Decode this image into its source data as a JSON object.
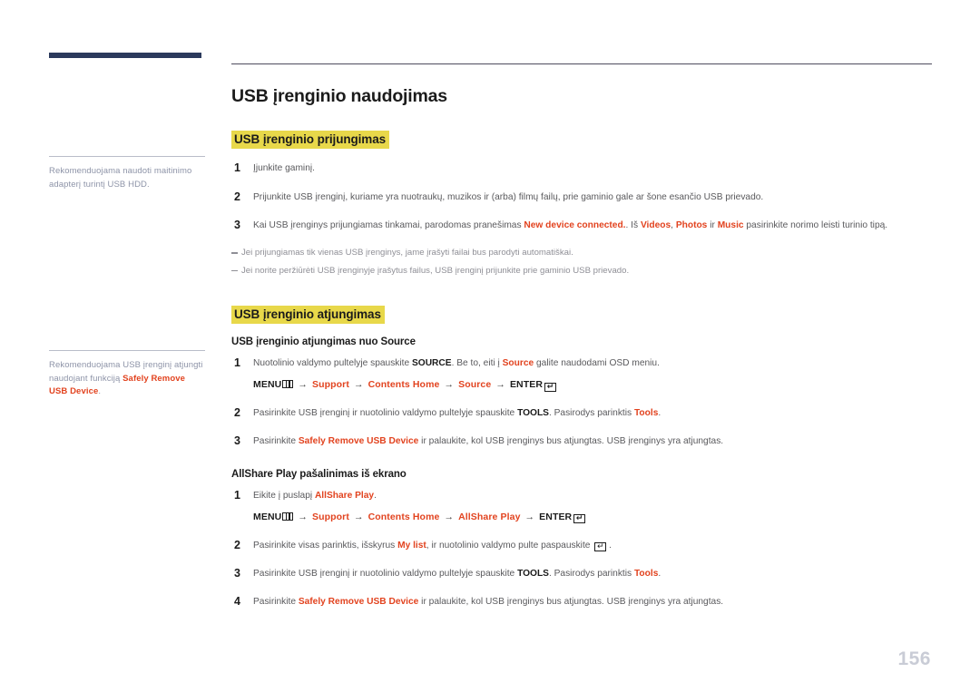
{
  "page": {
    "number": "156"
  },
  "sidebar": {
    "notes": [
      {
        "text_before": "Rekomenduojama naudoti maitinimo adapterį turintį USB HDD.",
        "emphasis": "",
        "text_after": ""
      },
      {
        "text_before": "Rekomenduojama USB įrenginį atjungti naudojant funkciją ",
        "emphasis": "Safely Remove USB Device",
        "text_after": "."
      }
    ]
  },
  "main": {
    "title": "USB įrenginio naudojimas",
    "sections": [
      {
        "heading": "USB įrenginio prijungimas",
        "steps": [
          {
            "num": "1",
            "parts": [
              {
                "t": "Įjunkite gaminį.",
                "s": "plain"
              }
            ]
          },
          {
            "num": "2",
            "parts": [
              {
                "t": "Prijunkite USB įrenginį, kuriame yra nuotraukų, muzikos ir (arba) filmų failų, prie gaminio gale ar šone esančio USB prievado.",
                "s": "plain"
              }
            ]
          },
          {
            "num": "3",
            "parts": [
              {
                "t": "Kai USB įrenginys prijungiamas tinkamai, parodomas pranešimas ",
                "s": "plain"
              },
              {
                "t": "New device connected.",
                "s": "hl"
              },
              {
                "t": ". Iš ",
                "s": "plain"
              },
              {
                "t": "Videos",
                "s": "hl"
              },
              {
                "t": ", ",
                "s": "plain"
              },
              {
                "t": "Photos",
                "s": "hl"
              },
              {
                "t": " ir ",
                "s": "plain"
              },
              {
                "t": "Music",
                "s": "hl"
              },
              {
                "t": " pasirinkite norimo leisti turinio tipą.",
                "s": "plain"
              }
            ]
          }
        ],
        "notes": [
          "Jei prijungiamas tik vienas USB įrenginys, jame įrašyti failai bus parodyti automatiškai.",
          "Jei norite peržiūrėti USB įrenginyje įrašytus failus, USB įrenginį prijunkite prie gaminio USB prievado."
        ]
      },
      {
        "heading": "USB įrenginio atjungimas",
        "subsections": [
          {
            "sub_heading": "USB įrenginio atjungimas nuo Source",
            "steps": [
              {
                "num": "1",
                "parts": [
                  {
                    "t": "Nuotolinio valdymo pultelyje spauskite ",
                    "s": "plain"
                  },
                  {
                    "t": "SOURCE",
                    "s": "bold"
                  },
                  {
                    "t": ". Be to, eiti į ",
                    "s": "plain"
                  },
                  {
                    "t": "Source",
                    "s": "hl"
                  },
                  {
                    "t": " galite naudodami OSD meniu.",
                    "s": "plain"
                  }
                ],
                "menupath": {
                  "lead": "MENU",
                  "items": [
                    "Support",
                    "Contents Home",
                    "Source"
                  ],
                  "tail": "ENTER"
                }
              },
              {
                "num": "2",
                "parts": [
                  {
                    "t": "Pasirinkite USB įrenginį ir nuotolinio valdymo pultelyje spauskite ",
                    "s": "plain"
                  },
                  {
                    "t": "TOOLS",
                    "s": "bold"
                  },
                  {
                    "t": ". Pasirodys parinktis ",
                    "s": "plain"
                  },
                  {
                    "t": "Tools",
                    "s": "hl"
                  },
                  {
                    "t": ".",
                    "s": "plain"
                  }
                ]
              },
              {
                "num": "3",
                "parts": [
                  {
                    "t": "Pasirinkite ",
                    "s": "plain"
                  },
                  {
                    "t": "Safely Remove USB Device",
                    "s": "hl"
                  },
                  {
                    "t": " ir palaukite, kol USB įrenginys bus atjungtas. USB įrenginys yra atjungtas.",
                    "s": "plain"
                  }
                ]
              }
            ]
          },
          {
            "sub_heading": "AllShare Play pašalinimas iš ekrano",
            "steps": [
              {
                "num": "1",
                "parts": [
                  {
                    "t": "Eikite į puslapį ",
                    "s": "plain"
                  },
                  {
                    "t": "AllShare Play",
                    "s": "hl"
                  },
                  {
                    "t": ".",
                    "s": "plain"
                  }
                ],
                "menupath": {
                  "lead": "MENU",
                  "items": [
                    "Support",
                    "Contents Home",
                    "AllShare Play"
                  ],
                  "tail": "ENTER"
                }
              },
              {
                "num": "2",
                "parts": [
                  {
                    "t": "Pasirinkite visas parinktis, išskyrus ",
                    "s": "plain"
                  },
                  {
                    "t": "My list",
                    "s": "hl"
                  },
                  {
                    "t": ", ir nuotolinio valdymo pulte paspauskite ",
                    "s": "plain"
                  },
                  {
                    "t": "[ENTER]",
                    "s": "enter"
                  },
                  {
                    "t": " .",
                    "s": "plain"
                  }
                ]
              },
              {
                "num": "3",
                "parts": [
                  {
                    "t": "Pasirinkite USB įrenginį ir nuotolinio valdymo pultelyje spauskite ",
                    "s": "plain"
                  },
                  {
                    "t": "TOOLS",
                    "s": "bold"
                  },
                  {
                    "t": ". Pasirodys parinktis ",
                    "s": "plain"
                  },
                  {
                    "t": "Tools",
                    "s": "hl"
                  },
                  {
                    "t": ".",
                    "s": "plain"
                  }
                ]
              },
              {
                "num": "4",
                "parts": [
                  {
                    "t": "Pasirinkite ",
                    "s": "plain"
                  },
                  {
                    "t": "Safely Remove USB Device",
                    "s": "hl"
                  },
                  {
                    "t": " ir palaukite, kol USB įrenginys bus atjungtas. USB įrenginys yra atjungtas.",
                    "s": "plain"
                  }
                ]
              }
            ]
          }
        ]
      }
    ]
  },
  "colors": {
    "accent_red": "#e2431f",
    "highlight_yellow": "#e8d84a",
    "sidebar_bar_navy": "#2b3a5c",
    "page_number_gray": "#c9ccd6"
  }
}
